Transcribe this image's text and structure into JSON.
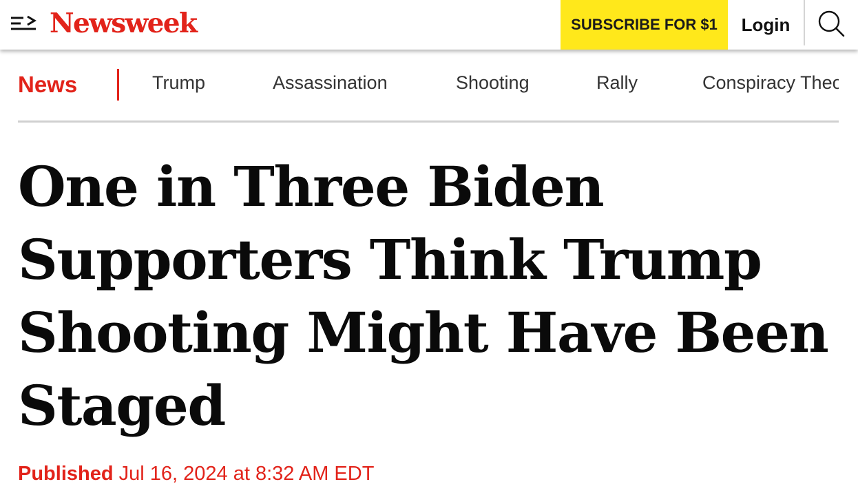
{
  "header": {
    "menu_icon": "menu-arrow-icon",
    "logo": "Newsweek",
    "subscribe_label": "SUBSCRIBE FOR $1",
    "login_label": "Login",
    "search_icon": "search-icon"
  },
  "section_nav": {
    "section_label": "News",
    "items": [
      "Trump",
      "Assassination",
      "Shooting",
      "Rally",
      "Conspiracy Theories"
    ]
  },
  "article": {
    "headline": "One in Three Biden Supporters Think Trump Shooting Might Have Been Staged",
    "published_label": "Published",
    "published_date": "Jul 16, 2024 at 8:32 AM EDT"
  },
  "colors": {
    "brand_red": "#e2231a",
    "subscribe_yellow": "#ffe81b"
  }
}
